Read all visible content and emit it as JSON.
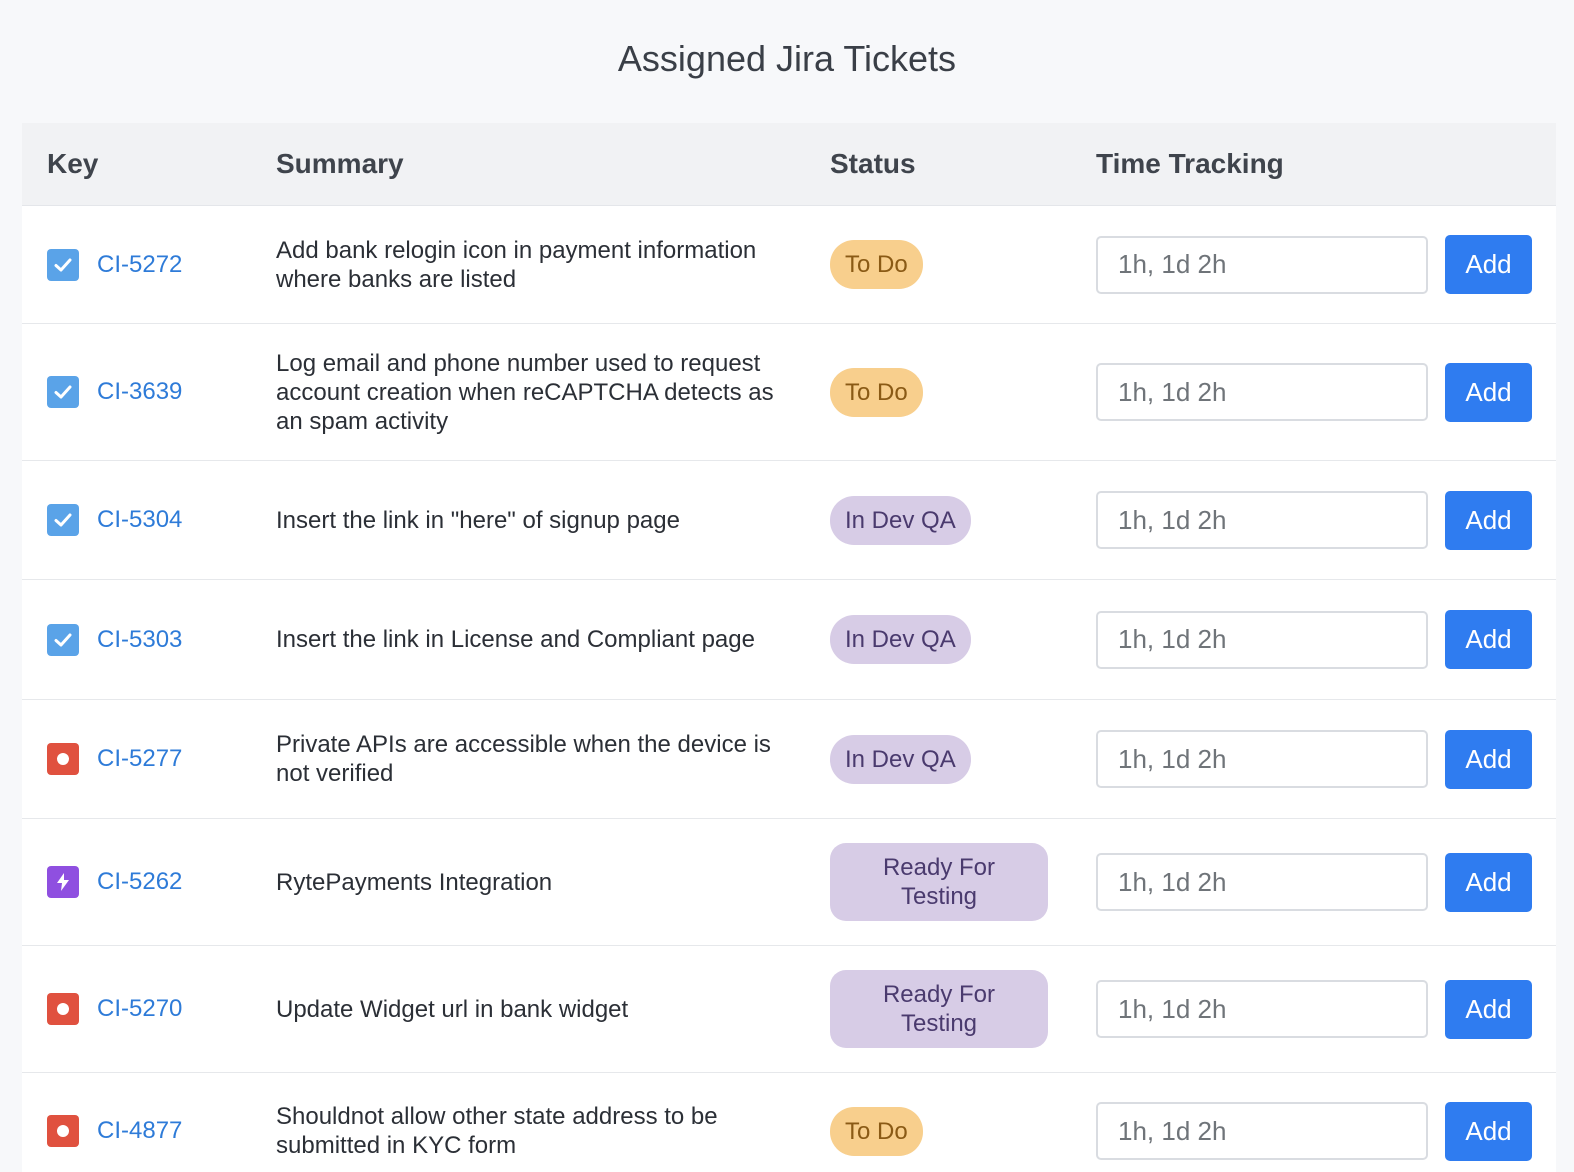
{
  "page": {
    "title": "Assigned Jira Tickets"
  },
  "table": {
    "headers": {
      "key": "Key",
      "summary": "Summary",
      "status": "Status",
      "time": "Time Tracking"
    },
    "rows": [
      {
        "type": "task",
        "type_icon": "checkbox-task-icon",
        "key": "CI-5272",
        "summary": "Add bank relogin icon in payment information where banks are listed",
        "status": "To Do",
        "status_kind": "todo",
        "time_placeholder": "1h, 1d 2h",
        "add_label": "Add"
      },
      {
        "type": "task",
        "type_icon": "checkbox-task-icon",
        "key": "CI-3639",
        "summary": "Log email and phone number used to request account creation when reCAPTCHA detects as an spam activity",
        "status": "To Do",
        "status_kind": "todo",
        "time_placeholder": "1h, 1d 2h",
        "add_label": "Add"
      },
      {
        "type": "task",
        "type_icon": "checkbox-task-icon",
        "key": "CI-5304",
        "summary": "Insert the link in \"here\" of signup page",
        "status": "In Dev QA",
        "status_kind": "qa",
        "time_placeholder": "1h, 1d 2h",
        "add_label": "Add"
      },
      {
        "type": "task",
        "type_icon": "checkbox-task-icon",
        "key": "CI-5303",
        "summary": "Insert the link in License and Compliant page",
        "status": "In Dev QA",
        "status_kind": "qa",
        "time_placeholder": "1h, 1d 2h",
        "add_label": "Add"
      },
      {
        "type": "bug",
        "type_icon": "bug-icon",
        "key": "CI-5277",
        "summary": "Private APIs are accessible when the device is not verified",
        "status": "In Dev QA",
        "status_kind": "qa",
        "time_placeholder": "1h, 1d 2h",
        "add_label": "Add"
      },
      {
        "type": "story",
        "type_icon": "lightning-story-icon",
        "key": "CI-5262",
        "summary": "RytePayments Integration",
        "status": "Ready For Testing",
        "status_kind": "ready",
        "time_placeholder": "1h, 1d 2h",
        "add_label": "Add"
      },
      {
        "type": "bug",
        "type_icon": "bug-icon",
        "key": "CI-5270",
        "summary": "Update Widget url in bank widget",
        "status": "Ready For Testing",
        "status_kind": "ready",
        "time_placeholder": "1h, 1d 2h",
        "add_label": "Add"
      },
      {
        "type": "bug",
        "type_icon": "bug-icon",
        "key": "CI-4877",
        "summary": "Shouldnot allow other state address to be submitted in KYC form",
        "status": "To Do",
        "status_kind": "todo",
        "time_placeholder": "1h, 1d 2h",
        "add_label": "Add"
      }
    ]
  },
  "colors": {
    "link": "#2e7bd8",
    "button": "#2f7cf0",
    "todo_badge": "#f8cf8d",
    "qa_badge": "#d7cce6",
    "task_icon": "#5aa3e8",
    "bug_icon": "#e0513f",
    "story_icon": "#8f4fe0"
  }
}
